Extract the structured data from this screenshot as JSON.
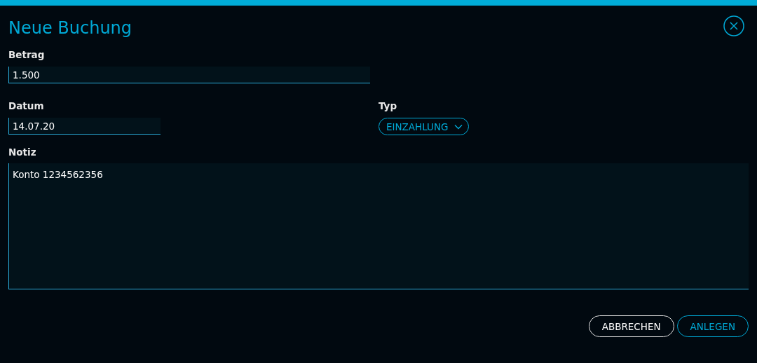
{
  "dialog": {
    "title": "Neue Buchung"
  },
  "fields": {
    "amount": {
      "label": "Betrag",
      "value": "1.500"
    },
    "date": {
      "label": "Datum",
      "value": "14.07.20"
    },
    "type": {
      "label": "Typ",
      "value": "EINZAHLUNG"
    },
    "note": {
      "label": "Notiz",
      "value": "Konto 1234562356"
    }
  },
  "buttons": [
    {
      "label": "ABBRECHEN",
      "kind": "secondary"
    },
    {
      "label": "ANLEGEN",
      "kind": "primary"
    }
  ]
}
